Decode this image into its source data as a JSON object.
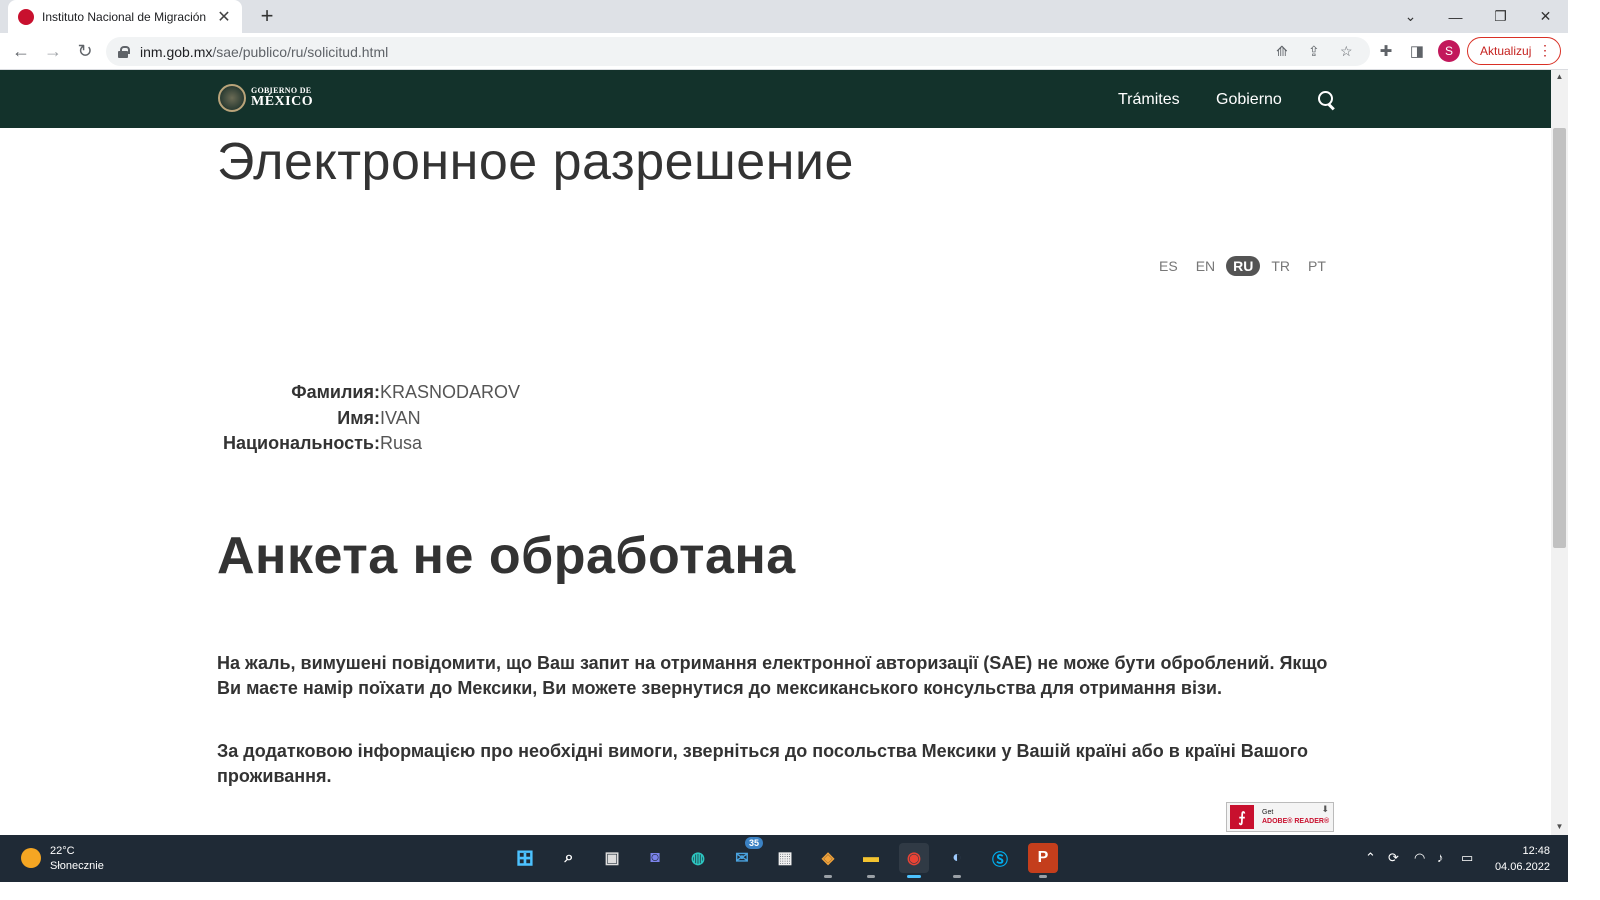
{
  "browser": {
    "tab_title": "Instituto Nacional de Migración",
    "new_tab_symbol": "+",
    "url_host": "inm.gob.mx",
    "url_path": "/sae/publico/ru/solicitud.html",
    "profile_initial": "S",
    "update_label": "Aktualizuj",
    "colors": {
      "favicon": "#c8102e",
      "profile": "#c2185b",
      "update": "#d93025"
    }
  },
  "site": {
    "logo_small": "GOBIERNO DE",
    "logo_big": "MÉXICO",
    "nav": [
      "Trámites",
      "Gobierno"
    ],
    "header_color": "#13322b"
  },
  "page": {
    "title": "Электронное разрешение",
    "languages": [
      "ES",
      "EN",
      "RU",
      "TR",
      "PT"
    ],
    "active_language": "RU",
    "applicant": [
      {
        "label": "Фамилия:",
        "value": "KRASNODAROV"
      },
      {
        "label": "Имя:",
        "value": "IVAN"
      },
      {
        "label": "Национальность:",
        "value": "Rusa"
      }
    ],
    "status_title": "Анкета не обработана",
    "paragraphs": [
      "На жаль, вимушені повідомити, що Ваш запит на отримання електронної авторизації (SAE) не може бути оброблений. Якщо Ви маєте намір поїхати до Мексики, Ви можете звернутися до мексиканського консульства для отримання візи.",
      "За додатковою інформацією про необхідні вимоги, зверніться до посольства Мексики у Вашій країні або в країні Вашого проживання."
    ],
    "adobe_badge": {
      "line1": "Get",
      "line2": "ADOBE® READER®"
    }
  },
  "taskbar": {
    "weather_temp": "22°C",
    "weather_desc": "Słonecznie",
    "mail_badge": "35",
    "time": "12:48",
    "date": "04.06.2022"
  }
}
